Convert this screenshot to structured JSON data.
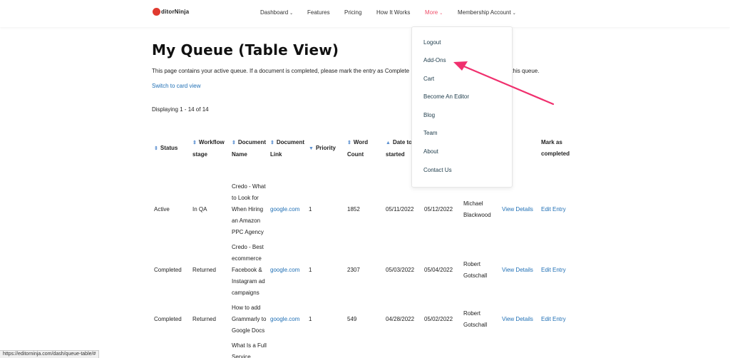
{
  "logo": {
    "text": "ditorNinja"
  },
  "nav": {
    "dashboard": "Dashboard",
    "features": "Features",
    "pricing": "Pricing",
    "how_it_works": "How It Works",
    "more": "More",
    "membership": "Membership Account",
    "caret": "⌄"
  },
  "page": {
    "title": "My Queue (Table View)",
    "description": "This page contains your active queue. If a document is completed, please mark the entry as Complete",
    "description_tail": "om this queue.",
    "switch_link": "Switch to card view",
    "displaying": "Displaying 1 - 14 of 14"
  },
  "table": {
    "headers": {
      "status": "Status",
      "workflow_1": "Workflow",
      "workflow_2": "stage",
      "docname_1": "Document",
      "docname_2": "Name",
      "doclink_1": "Document",
      "doclink_2": "Link",
      "priority": "Priority",
      "word_1": "Word",
      "word_2": "Count",
      "date_1": "Date to",
      "date_2": "started",
      "mark_1": "Mark as",
      "mark_2": "completed"
    },
    "rows": [
      {
        "status": "Active",
        "stage": "In QA",
        "name": [
          "Credo - What",
          "to Look for",
          "When Hiring",
          "an Amazon",
          "PPC Agency"
        ],
        "link": "google.com",
        "priority": "1",
        "words": "1852",
        "date1": "05/11/2022",
        "date2": "05/12/2022",
        "editor": [
          "Michael",
          "Blackwood"
        ],
        "details": "View Details",
        "edit": "Edit Entry"
      },
      {
        "status": "Completed",
        "stage": "Returned",
        "name": [
          "Credo - Best",
          "ecommerce",
          "Facebook &",
          "Instagram ad",
          "campaigns"
        ],
        "link": "google.com",
        "priority": "1",
        "words": "2307",
        "date1": "05/03/2022",
        "date2": "05/04/2022",
        "editor": [
          "Robert",
          "Gotschall"
        ],
        "details": "View Details",
        "edit": "Edit Entry"
      },
      {
        "status": "Completed",
        "stage": "Returned",
        "name": [
          "How to add",
          "Grammarly to",
          "Google Docs"
        ],
        "link": "google.com",
        "priority": "1",
        "words": "549",
        "date1": "04/28/2022",
        "date2": "05/02/2022",
        "editor": [
          "Robert",
          "Gotschall"
        ],
        "details": "View Details",
        "edit": "Edit Entry"
      }
    ],
    "partial_row": [
      "What Is a Full",
      "Service"
    ]
  },
  "dropdown": {
    "items": [
      "Logout",
      "Add-Ons",
      "Cart",
      "Become An Editor",
      "Blog",
      "Team",
      "About",
      "Contact Us"
    ]
  },
  "statusbar": {
    "url": "https://editorninja.com/dash/queue-table/#"
  },
  "colors": {
    "accent": "#ef4f6a",
    "link": "#1f6fb5",
    "arrow": "#f0306e"
  },
  "icons": {
    "sort_both": "⇕",
    "sort_down": "▼",
    "sort_up": "▲"
  }
}
